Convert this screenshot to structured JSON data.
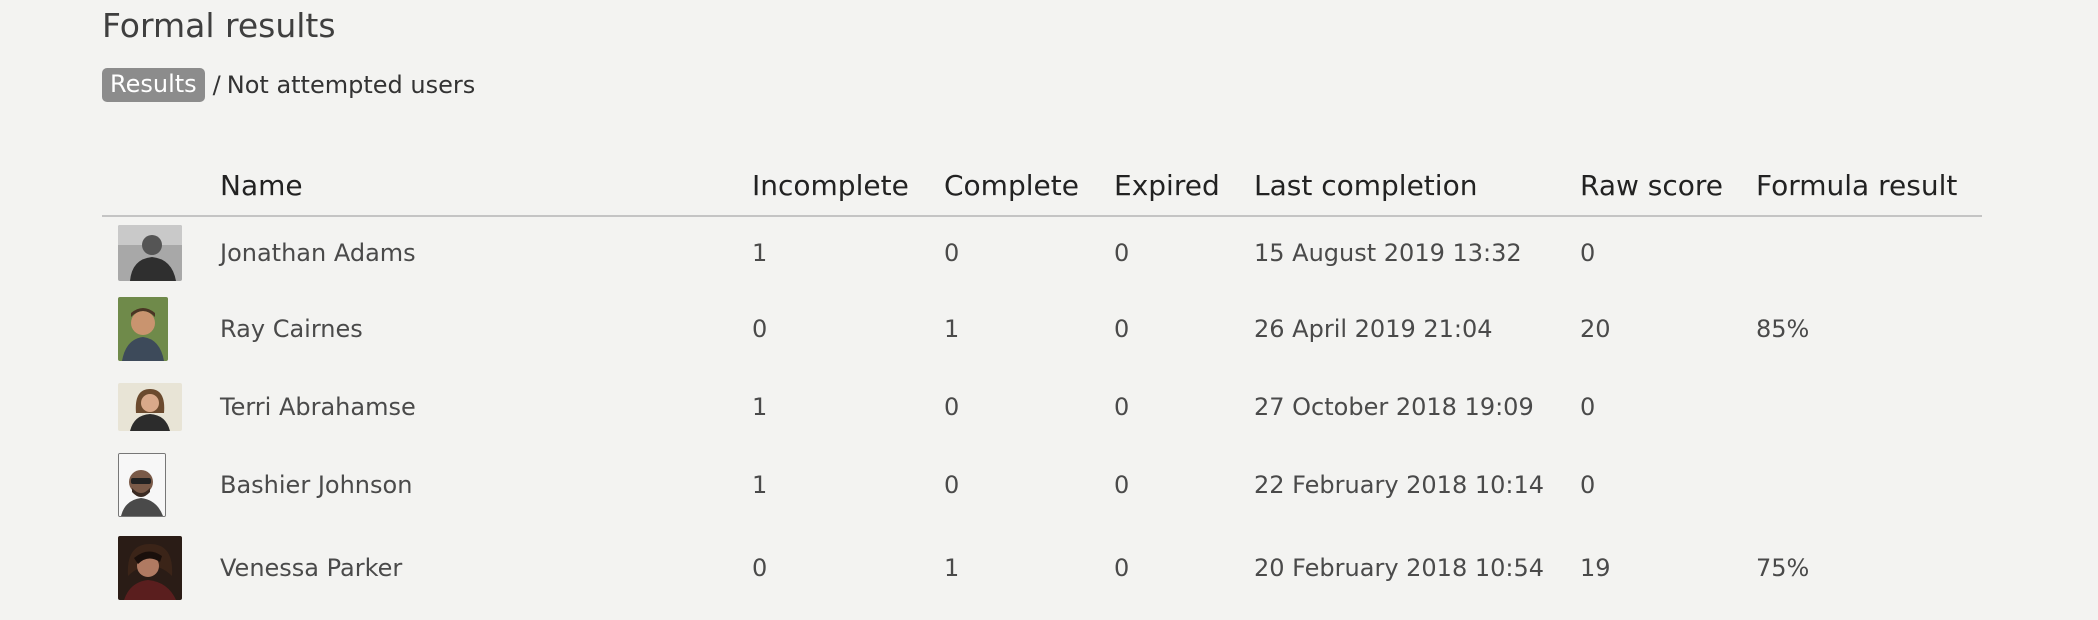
{
  "page": {
    "title": "Formal results"
  },
  "breadcrumb": {
    "active": "Results",
    "separator": "/",
    "link": "Not attempted users",
    "active_bg": "#8c8c8c"
  },
  "table": {
    "headers": [
      "",
      "Name",
      "Incomplete",
      "Complete",
      "Expired",
      "Last completion",
      "Raw score",
      "Formula result"
    ],
    "rows": [
      {
        "avatar": "user-photo",
        "name": "Jonathan Adams",
        "incomplete": "1",
        "complete": "0",
        "expired": "0",
        "last_completion": "15 August 2019 13:32",
        "raw_score": "0",
        "formula_result": ""
      },
      {
        "avatar": "user-photo",
        "name": "Ray Cairnes",
        "incomplete": "0",
        "complete": "1",
        "expired": "0",
        "last_completion": "26 April 2019 21:04",
        "raw_score": "20",
        "formula_result": "85%"
      },
      {
        "avatar": "user-photo",
        "name": "Terri Abrahamse",
        "incomplete": "1",
        "complete": "0",
        "expired": "0",
        "last_completion": "27 October 2018 19:09",
        "raw_score": "0",
        "formula_result": ""
      },
      {
        "avatar": "user-photo",
        "name": "Bashier Johnson",
        "incomplete": "1",
        "complete": "0",
        "expired": "0",
        "last_completion": "22 February 2018 10:14",
        "raw_score": "0",
        "formula_result": ""
      },
      {
        "avatar": "user-photo",
        "name": "Venessa Parker",
        "incomplete": "0",
        "complete": "1",
        "expired": "0",
        "last_completion": "20 February 2018 10:54",
        "raw_score": "19",
        "formula_result": "75%"
      }
    ]
  }
}
